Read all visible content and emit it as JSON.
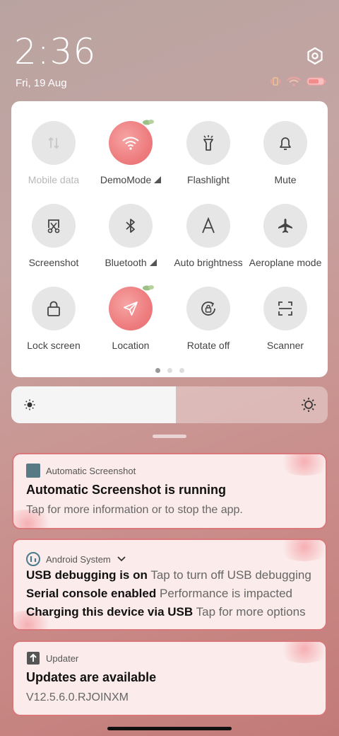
{
  "status": {
    "time": "2:36",
    "date": "Fri, 19 Aug"
  },
  "quick_settings": {
    "tiles": [
      {
        "label": "Mobile data",
        "icon": "mobile-data-icon",
        "active": false,
        "disabled": true
      },
      {
        "label": "DemoMode",
        "icon": "wifi-icon",
        "active": true,
        "has_arrow": true
      },
      {
        "label": "Flashlight",
        "icon": "flashlight-icon",
        "active": false
      },
      {
        "label": "Mute",
        "icon": "bell-icon",
        "active": false
      },
      {
        "label": "Screenshot",
        "icon": "screenshot-icon",
        "active": false
      },
      {
        "label": "Bluetooth",
        "icon": "bluetooth-icon",
        "active": false,
        "has_arrow": true
      },
      {
        "label": "Auto brightness",
        "icon": "auto-brightness-icon",
        "active": false
      },
      {
        "label": "Aeroplane mode",
        "icon": "airplane-icon",
        "active": false
      },
      {
        "label": "Lock screen",
        "icon": "lock-icon",
        "active": false
      },
      {
        "label": "Location",
        "icon": "location-icon",
        "active": true
      },
      {
        "label": "Rotate off",
        "icon": "rotate-lock-icon",
        "active": false
      },
      {
        "label": "Scanner",
        "icon": "scanner-icon",
        "active": false
      }
    ],
    "page_index": 1,
    "page_count": 3
  },
  "brightness": {
    "level": 0.52
  },
  "notifications": [
    {
      "app": "Automatic Screenshot",
      "title": "Automatic Screenshot is running",
      "body": "Tap for more information or to stop the app."
    },
    {
      "app": "Android System",
      "lines": [
        {
          "title": "USB debugging is on",
          "text": "Tap to turn off USB debugging"
        },
        {
          "title": "Serial console enabled",
          "text": "Performance is impacted"
        },
        {
          "title": "Charging this device via USB",
          "text": "Tap for more options"
        }
      ]
    },
    {
      "app": "Updater",
      "title": "Updates are available",
      "body": "V12.5.6.0.RJOINXM"
    }
  ],
  "colors": {
    "accent": "#e56b6e",
    "notification_border": "#d9787b",
    "notification_bg": "#fbeceb"
  }
}
